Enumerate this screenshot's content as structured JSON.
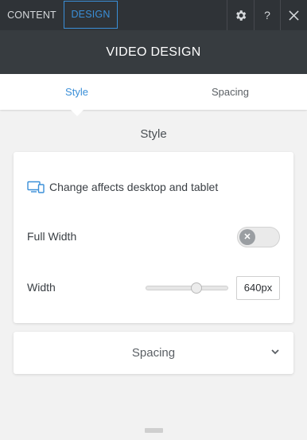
{
  "top_tabs": {
    "content": "CONTENT",
    "design": "DESIGN"
  },
  "top_icons": {
    "gear": "gear-icon",
    "help": "?",
    "close": "close-icon"
  },
  "title": "VIDEO DESIGN",
  "sub_tabs": {
    "style": "Style",
    "spacing": "Spacing"
  },
  "section_title": "Style",
  "style_card": {
    "device_note": "Change affects desktop and tablet",
    "full_width": {
      "label": "Full Width",
      "enabled": false
    },
    "width": {
      "label": "Width",
      "value": "640px",
      "slider_fraction": 0.62
    }
  },
  "spacing_card": {
    "label": "Spacing"
  },
  "colors": {
    "accent": "#3a8fd8",
    "topbar": "#2f3337",
    "titlebar": "#373c40"
  }
}
